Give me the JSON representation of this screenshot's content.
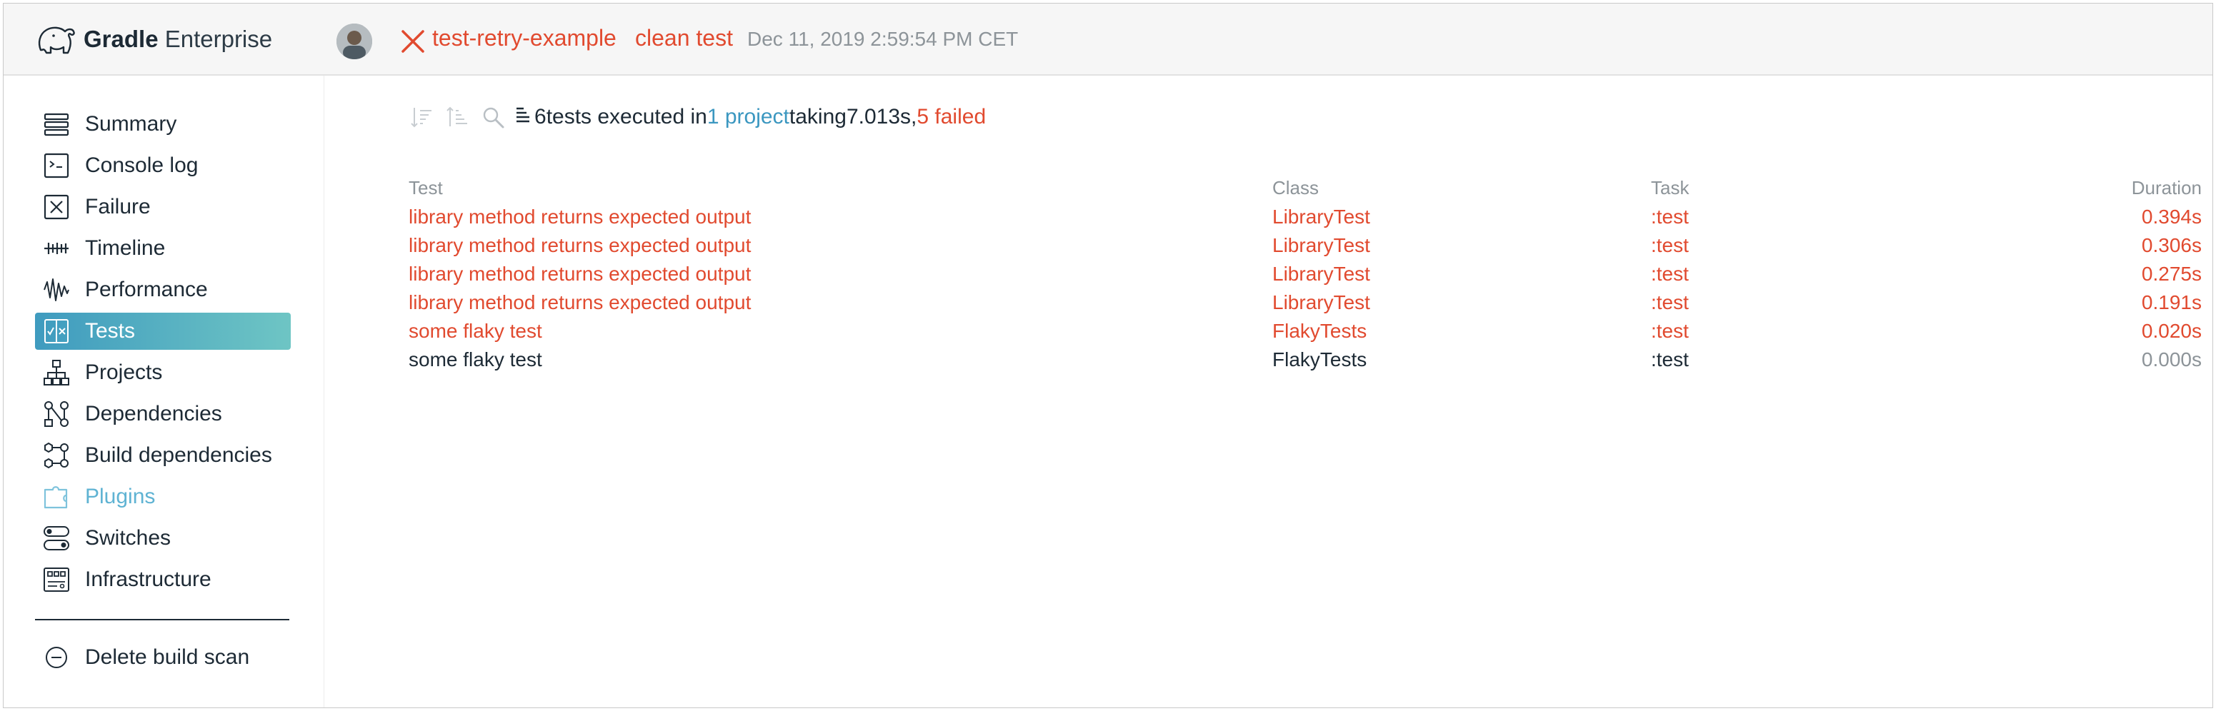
{
  "brand": {
    "bold": "Gradle",
    "light": " Enterprise"
  },
  "build": {
    "project": "test-retry-example",
    "tasks": "clean test",
    "date": "Dec 11, 2019 2:59:54 PM CET",
    "status": "failed"
  },
  "sidebar": {
    "items": [
      {
        "label": "Summary",
        "icon": "summary-icon"
      },
      {
        "label": "Console log",
        "icon": "console-icon"
      },
      {
        "label": "Failure",
        "icon": "failure-icon"
      },
      {
        "label": "Timeline",
        "icon": "timeline-icon"
      },
      {
        "label": "Performance",
        "icon": "performance-icon"
      },
      {
        "label": "Tests",
        "icon": "tests-icon",
        "active": true
      },
      {
        "label": "Projects",
        "icon": "projects-icon"
      },
      {
        "label": "Dependencies",
        "icon": "dependencies-icon"
      },
      {
        "label": "Build dependencies",
        "icon": "build-dependencies-icon"
      },
      {
        "label": "Plugins",
        "icon": "plugins-icon",
        "muted": true
      },
      {
        "label": "Switches",
        "icon": "switches-icon"
      },
      {
        "label": "Infrastructure",
        "icon": "infrastructure-icon"
      }
    ],
    "delete": {
      "label": "Delete build scan",
      "icon": "minus-circle-icon"
    }
  },
  "tests_summary": {
    "count": "6",
    "tests_executed_in": " tests executed in ",
    "project_link": "1 project",
    "taking": " taking ",
    "duration": "7.013s",
    "comma": ", ",
    "failed": "5 failed"
  },
  "table": {
    "columns": {
      "test": "Test",
      "class": "Class",
      "task": "Task",
      "duration": "Duration"
    },
    "rows": [
      {
        "test": "library method returns expected output",
        "class": "LibraryTest",
        "task": ":test",
        "duration": "0.394s",
        "status": "failed"
      },
      {
        "test": "library method returns expected output",
        "class": "LibraryTest",
        "task": ":test",
        "duration": "0.306s",
        "status": "failed"
      },
      {
        "test": "library method returns expected output",
        "class": "LibraryTest",
        "task": ":test",
        "duration": "0.275s",
        "status": "failed"
      },
      {
        "test": "library method returns expected output",
        "class": "LibraryTest",
        "task": ":test",
        "duration": "0.191s",
        "status": "failed"
      },
      {
        "test": "some flaky test",
        "class": "FlakyTests",
        "task": ":test",
        "duration": "0.020s",
        "status": "failed"
      },
      {
        "test": "some flaky test",
        "class": "FlakyTests",
        "task": ":test",
        "duration": "0.000s",
        "status": "passed"
      }
    ]
  },
  "colors": {
    "failed": "#e14a2f",
    "link": "#3b97c0",
    "active_start": "#3f9bbf",
    "active_end": "#6ec5c4"
  }
}
